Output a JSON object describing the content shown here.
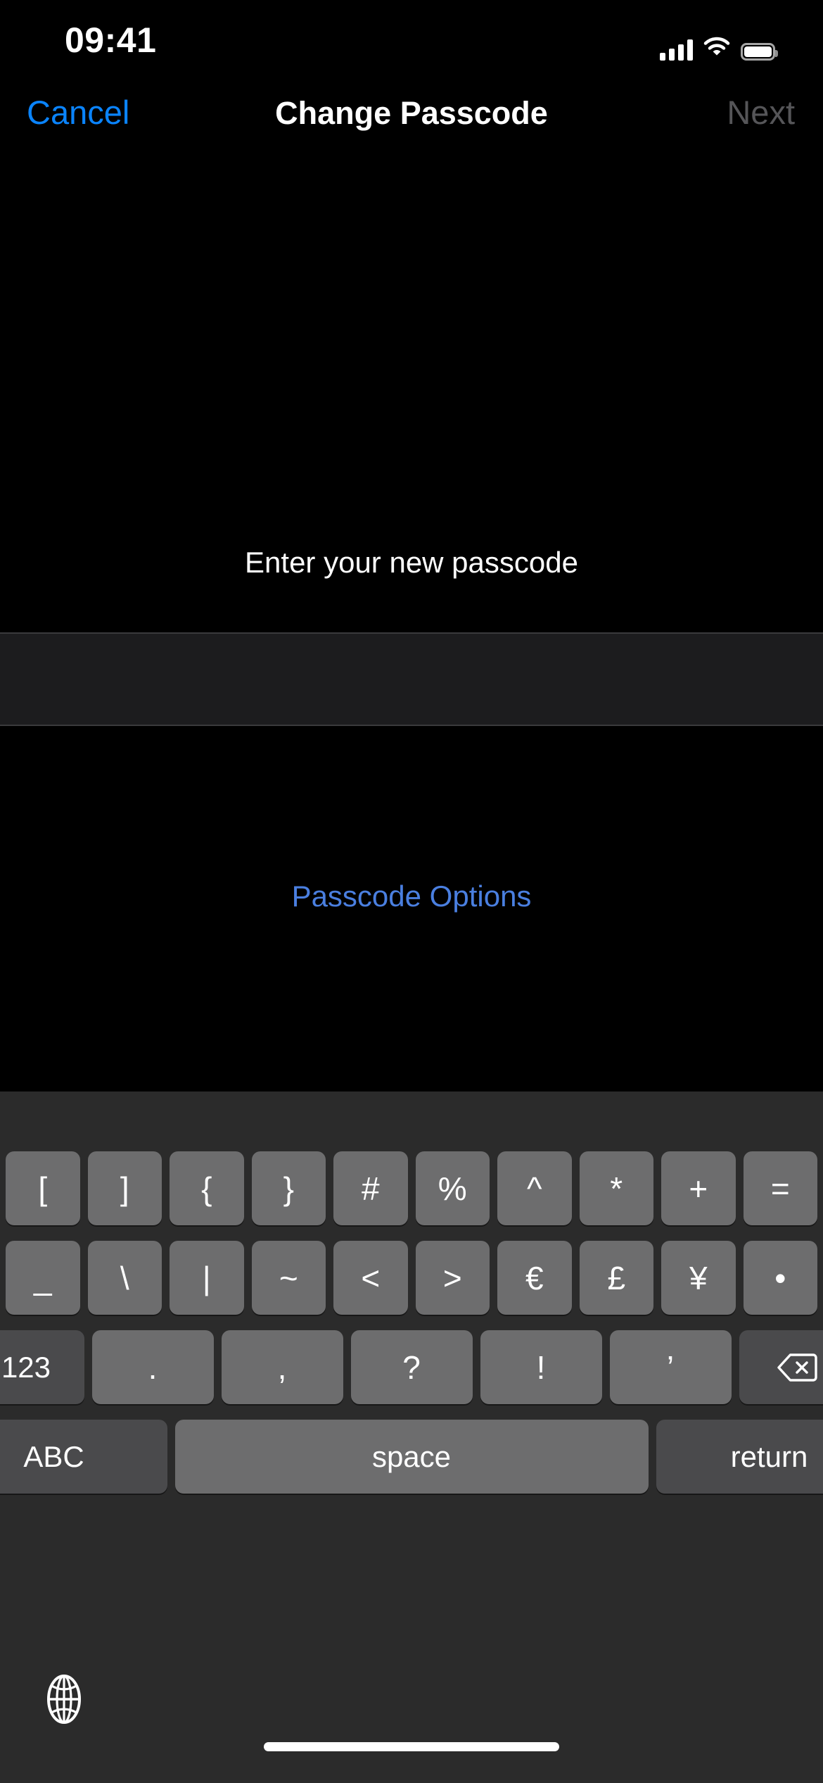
{
  "status_bar": {
    "time": "09:41",
    "cellular_icon": "signal-bars-icon",
    "wifi_icon": "wifi-icon",
    "battery_icon": "battery-full-icon",
    "battery_level": "100"
  },
  "nav_bar": {
    "cancel_label": "Cancel",
    "title": "Change Passcode",
    "next_label": "Next",
    "cancel_color": "#0a84ff",
    "next_color": "#555558"
  },
  "main": {
    "prompt": "Enter your new passcode",
    "passcode_value": "",
    "passcode_placeholder": "",
    "options_label": "Passcode Options",
    "options_color": "#4a7fe0"
  },
  "keyboard": {
    "type": "symbols",
    "background_color": "#2b2b2b",
    "key_color": "#6d6d6e",
    "dark_key_color": "#4a4a4c",
    "row1": [
      "[",
      "]",
      "{",
      "}",
      "#",
      "%",
      "^",
      "*",
      "+",
      "="
    ],
    "row2": [
      "_",
      "\\",
      "|",
      "~",
      "<",
      ">",
      "€",
      "£",
      "¥",
      "•"
    ],
    "row3": {
      "numeric_label": "123",
      "keys": [
        ".",
        ",",
        "?",
        "!",
        "’"
      ],
      "delete_icon": "delete-backspace-icon"
    },
    "row4": {
      "abc_label": "ABC",
      "space_label": "space",
      "return_label": "return"
    },
    "globe_icon": "globe-language-icon"
  },
  "home_indicator": {
    "visible": "true"
  }
}
